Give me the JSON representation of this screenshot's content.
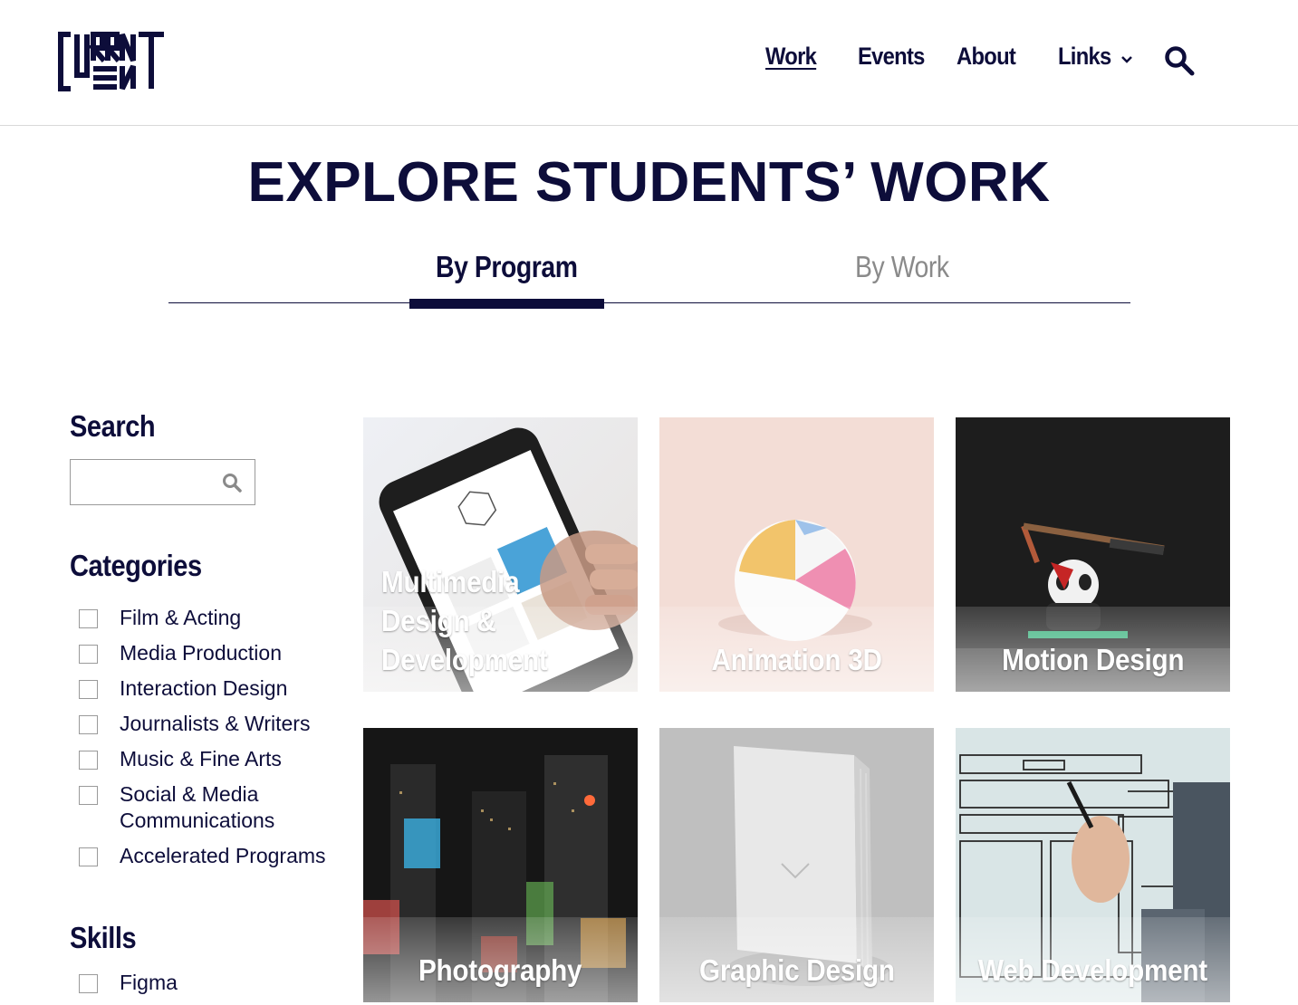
{
  "brand": {
    "logo_text": "CURRENT"
  },
  "nav": {
    "items": [
      {
        "label": "Work",
        "active": true
      },
      {
        "label": "Events",
        "active": false
      },
      {
        "label": "About",
        "active": false
      },
      {
        "label": "Links",
        "active": false,
        "has_dropdown": true
      }
    ],
    "search_icon": "search-icon"
  },
  "page": {
    "title": "EXPLORE STUDENTS’ WORK"
  },
  "tabs": [
    {
      "label": "By Program",
      "selected": true
    },
    {
      "label": "By Work",
      "selected": false
    }
  ],
  "sidebar": {
    "search": {
      "heading": "Search",
      "value": "",
      "placeholder": ""
    },
    "categories": {
      "heading": "Categories",
      "items": [
        "Film & Acting",
        "Media Production",
        "Interaction Design",
        "Journalists & Writers",
        "Music & Fine Arts",
        "Social & Media Communications",
        "Accelerated Programs"
      ]
    },
    "skills": {
      "heading": "Skills",
      "items": [
        "Figma"
      ]
    }
  },
  "programs": [
    {
      "title": "Multimedia Design & Development"
    },
    {
      "title": "Animation 3D"
    },
    {
      "title": "Motion Design"
    },
    {
      "title": "Photography"
    },
    {
      "title": "Graphic Design"
    },
    {
      "title": "Web Development"
    }
  ],
  "colors": {
    "brand_navy": "#0d0d3a",
    "muted_tab": "#8a8a8a",
    "border": "#9a9a9a"
  }
}
